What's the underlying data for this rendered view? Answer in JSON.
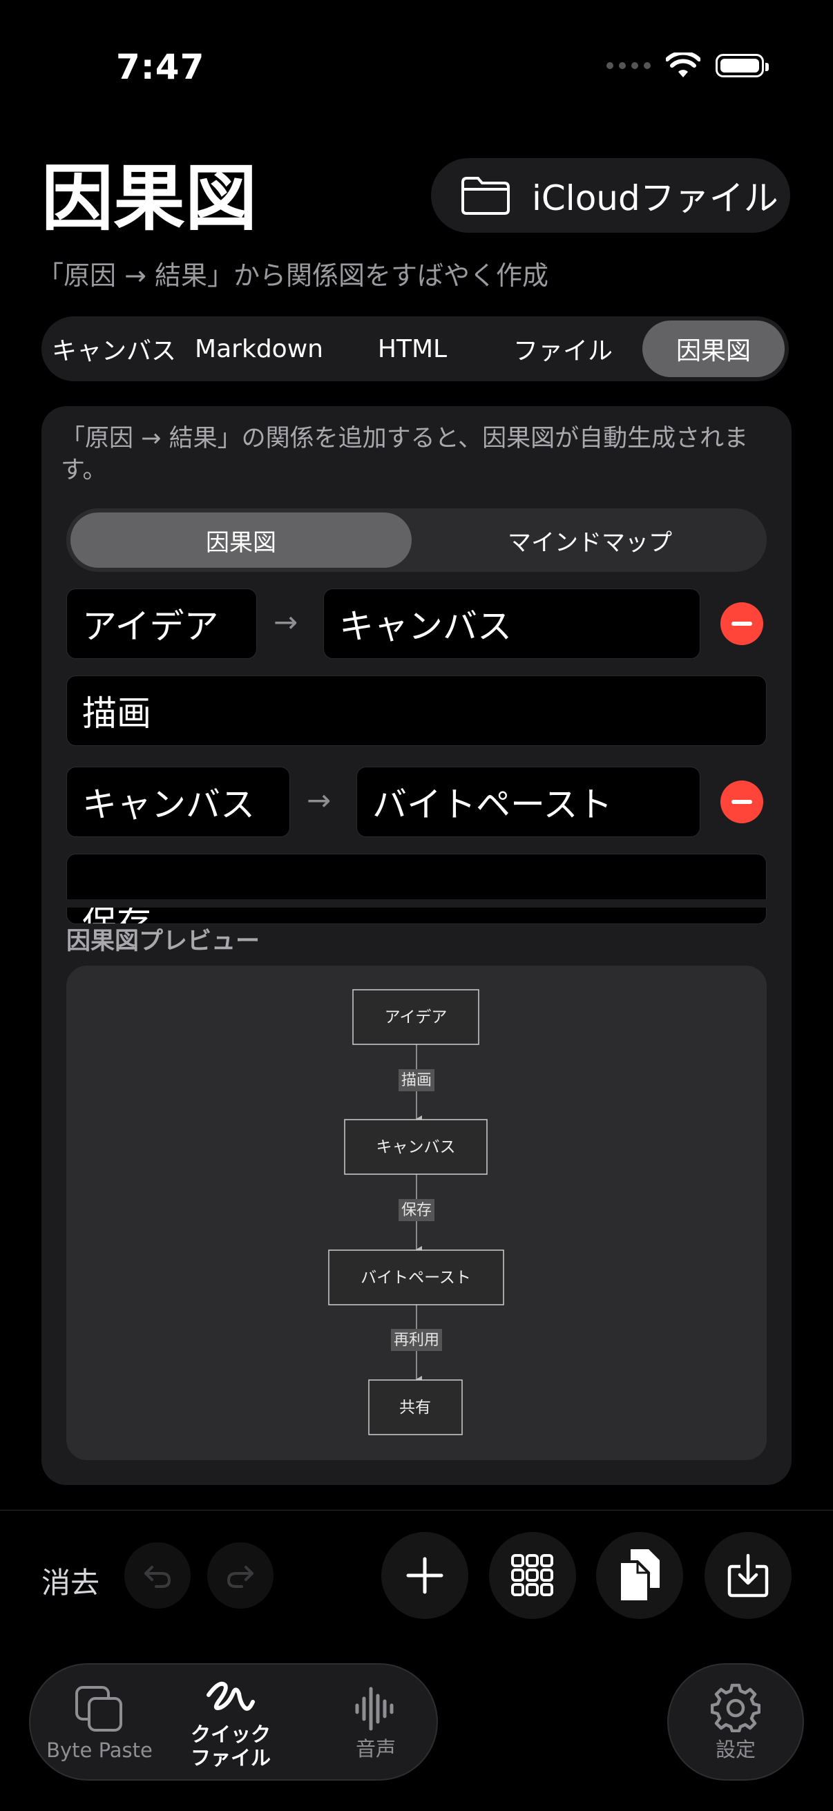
{
  "status": {
    "time": "7:47"
  },
  "header": {
    "title": "因果図",
    "icloud_label": "iCloudファイル",
    "subtitle": "「原因 → 結果」から関係図をすばやく作成"
  },
  "tabs": [
    {
      "label": "キャンバス",
      "selected": false
    },
    {
      "label": "Markdown",
      "selected": false
    },
    {
      "label": "HTML",
      "selected": false
    },
    {
      "label": "ファイル",
      "selected": false
    },
    {
      "label": "因果図",
      "selected": true
    }
  ],
  "editor": {
    "hint": "「原因 → 結果」の関係を追加すると、因果図が自動生成されます。",
    "modes": [
      {
        "label": "因果図",
        "selected": true
      },
      {
        "label": "マインドマップ",
        "selected": false
      }
    ],
    "relations": [
      {
        "cause": "アイデア",
        "effect": "キャンバス",
        "label": "描画"
      },
      {
        "cause": "キャンバス",
        "effect": "バイトペースト",
        "label": "保存"
      }
    ],
    "arrow": "→"
  },
  "preview": {
    "label": "因果図プレビュー",
    "nodes": [
      "アイデア",
      "キャンバス",
      "バイトペースト",
      "共有"
    ],
    "edges": [
      "描画",
      "保存",
      "再利用"
    ]
  },
  "toolbar": {
    "clear_label": "消去"
  },
  "tabbar": {
    "items": [
      {
        "label": "Byte Paste",
        "icon": "squares-icon",
        "active": false
      },
      {
        "label": "クイック\nファイル",
        "icon": "scribble-icon",
        "active": true
      },
      {
        "label": "音声",
        "icon": "waveform-icon",
        "active": false
      }
    ],
    "settings_label": "設定"
  }
}
